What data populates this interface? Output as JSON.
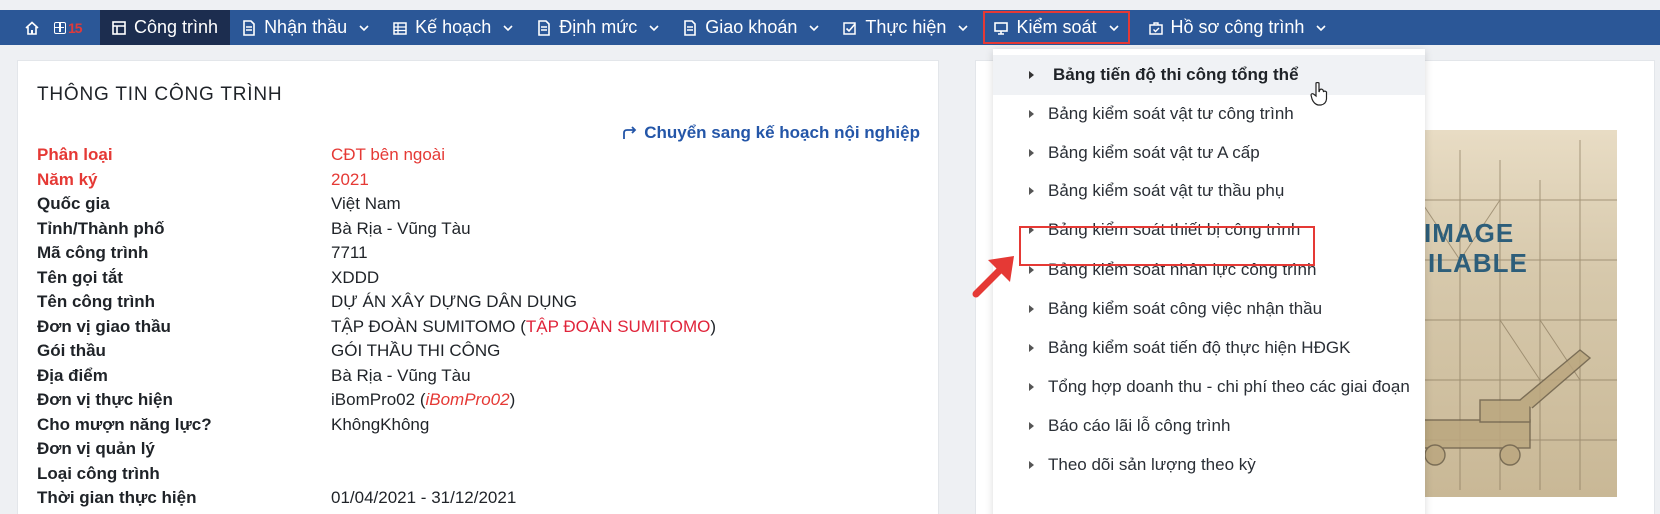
{
  "nav": {
    "items": [
      {
        "label": "Công trình",
        "icon": "grid-doc-icon"
      },
      {
        "label": "Nhận thầu",
        "icon": "document-icon"
      },
      {
        "label": "Kế hoạch",
        "icon": "table-icon"
      },
      {
        "label": "Định mức",
        "icon": "document-icon"
      },
      {
        "label": "Giao khoán",
        "icon": "document-icon"
      },
      {
        "label": "Thực hiện",
        "icon": "checkbox-icon"
      },
      {
        "label": "Kiểm soát",
        "icon": "monitor-icon"
      },
      {
        "label": "Hồ sơ công trình",
        "icon": "briefcase-check-icon"
      }
    ],
    "grid_badge": "15"
  },
  "info": {
    "title": "THÔNG TIN CÔNG TRÌNH",
    "plan_link": "Chuyển sang kế hoạch nội nghiệp",
    "rows": [
      {
        "label": "Phân loại",
        "value": "CĐT bên ngoài"
      },
      {
        "label": "Năm ký",
        "value": "2021"
      },
      {
        "label": "Quốc gia",
        "value": "Việt Nam"
      },
      {
        "label": "Tỉnh/Thành phố",
        "value": "Bà Rịa - Vũng Tàu"
      },
      {
        "label": "Mã công trình",
        "value": "7711"
      },
      {
        "label": "Tên gọi tắt",
        "value": "XDDD"
      },
      {
        "label": "Tên công trình",
        "value": "DỰ ÁN XÂY DỰNG DÂN DỤNG"
      },
      {
        "label": "Đơn vị giao thầu",
        "value": "TẬP ĐOÀN SUMITOMO (",
        "value_extra": "TẬP ĐOÀN SUMITOMO",
        "value_tail": ")"
      },
      {
        "label": "Gói thầu",
        "value": "GÓI THẦU THI CÔNG"
      },
      {
        "label": "Địa điểm",
        "value": "Bà Rịa - Vũng Tàu"
      },
      {
        "label": "Đơn vị thực hiện",
        "value": "iBomPro02 (",
        "value_extra": "iBomPro02",
        "value_tail": ")"
      },
      {
        "label": "Cho mượn năng lực?",
        "value": "KhôngKhông"
      },
      {
        "label": "Đơn vị quản lý",
        "value": ""
      },
      {
        "label": "Loại công trình",
        "value": ""
      },
      {
        "label": "Thời gian thực hiện",
        "value": "01/04/2021 - 31/12/2021"
      }
    ]
  },
  "dropdown": {
    "items": [
      "Bảng tiến độ thi công tổng thể",
      "Bảng kiểm soát vật tư công trình",
      "Bảng kiểm soát vật tư A cấp",
      "Bảng kiểm soát vật tư thầu phụ",
      "Bảng kiểm soát thiết bị công trình",
      "Bảng kiểm soát nhân lực công trình",
      "Bảng kiểm soát công việc nhận thầu",
      "Bảng kiểm soát tiến độ thực hiện HĐGK",
      "Tổng hợp doanh thu - chi phí theo các giai đoạn",
      "Báo cáo lãi lỗ công trình",
      "Theo dõi sản lượng theo kỳ"
    ]
  },
  "no_image": {
    "line1": "IMAGE",
    "line2": "ILABLE"
  },
  "colors": {
    "nav_bg": "#2b5797",
    "nav_active": "#1c2d4f",
    "highlight": "#e53935",
    "link": "#2456a8"
  }
}
